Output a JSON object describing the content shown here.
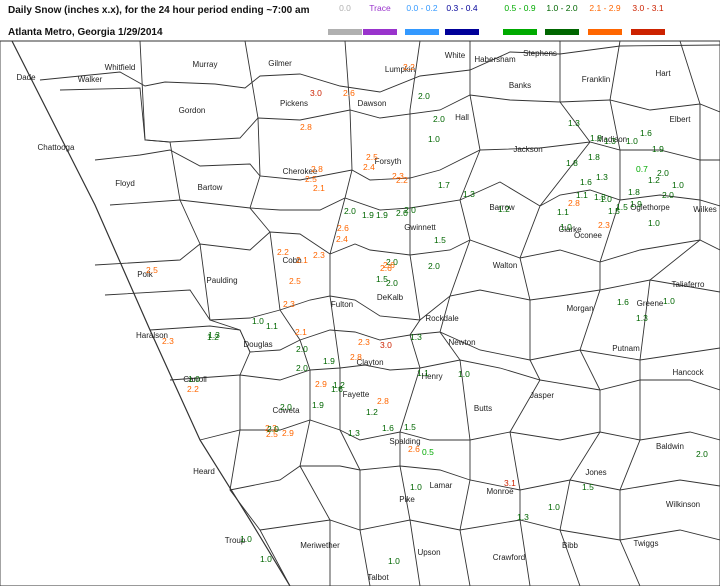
{
  "title": {
    "line1": "Daily Snow (inches x.x),  for the 24 hour period ending ~7:00 am",
    "line2": "Atlanta Metro, Georgia  1/29/2014"
  },
  "legend": [
    {
      "label": "0.0",
      "color": "#b0b0b0"
    },
    {
      "label": "Trace",
      "color": "#9933cc"
    },
    {
      "label": "0.0 - 0.2",
      "color": "#3399ff"
    },
    {
      "label": "0.3 - 0.4",
      "color": "#000099"
    },
    {
      "label": "0.5 - 0.9",
      "color": "#00aa00"
    },
    {
      "label": "1.0 - 2.0",
      "color": "#006600"
    },
    {
      "label": "2.1 - 2.9",
      "color": "#ff6600"
    },
    {
      "label": "3.0 - 3.1",
      "color": "#cc2200"
    }
  ],
  "counties": [
    "Dade",
    "Walker",
    "Whitfield",
    "Murray",
    "Gilmer",
    "Lumpkin",
    "White",
    "Habersham",
    "Stephens",
    "Franklin",
    "Hart",
    "Gordon",
    "Pickens",
    "Dawson",
    "Hall",
    "Banks",
    "Elbert",
    "Madison",
    "Chattooga",
    "Floyd",
    "Bartow",
    "Cherokee",
    "Forsyth",
    "Jackson",
    "Clarke",
    "Oglethorpe",
    "Wilkes",
    "Barrow",
    "Gwinnett",
    "Oconee",
    "Polk",
    "Paulding",
    "Cobb",
    "Walton",
    "Taliaferro",
    "Fulton",
    "DeKalb",
    "Rockdale",
    "Morgan",
    "Greene",
    "Haralson",
    "Douglas",
    "Newton",
    "Carroll",
    "Clayton",
    "Putnam",
    "Hancock",
    "Henry",
    "Jasper",
    "Fayette",
    "Coweta",
    "Butts",
    "Spalding",
    "Baldwin",
    "Heard",
    "Jones",
    "Lamar",
    "Monroe",
    "Pike",
    "Wilkinson",
    "Troup",
    "Meriwether",
    "Upson",
    "Bibb",
    "Twiggs",
    "Crawford",
    "Talbot"
  ],
  "observations": [
    "2.2",
    "3.0",
    "2.6",
    "2.0",
    "1.0",
    "2.0",
    "2.8",
    "2.5",
    "2.4",
    "2.3",
    "2.2",
    "1.3",
    "1.8",
    "1.3",
    "1.0",
    "1.7",
    "1.8",
    "1.2",
    "1.9",
    "2.8",
    "2.5",
    "2.1",
    "2.0",
    "2.0",
    "1.9",
    "2.0",
    "1.5",
    "2.6",
    "2.4",
    "2.3",
    "2.2",
    "2.1",
    "2.5",
    "2.3",
    "2.1",
    "2.0",
    "2.0",
    "1.9",
    "1.5",
    "2.0",
    "2.6",
    "2.6",
    "2.3",
    "2.0",
    "2.0",
    "1.3",
    "2.5",
    "2.3",
    "2.2",
    "1.0",
    "2.3",
    "2.0",
    "2.5",
    "2.0",
    "2.9",
    "1.9",
    "1.2",
    "1.6",
    "2.9",
    "2.8",
    "3.0",
    "1.1",
    "1.0",
    "1.3",
    "1.5",
    "2.6",
    "2.8",
    "1.6",
    "1.2",
    "1.3",
    "3.1",
    "1.0",
    "1.5",
    "1.3",
    "1.0",
    "0.5",
    "1.0",
    "1.0",
    "1.0",
    "1.2",
    "1.0",
    "1.1",
    "1.3",
    "1.6",
    "1.9",
    "2.0",
    "2.0",
    "1.0",
    "0.7",
    "1.0",
    "1.0",
    "1.9",
    "1.5",
    "1.8",
    "1.3",
    "1.0",
    "1.1",
    "1.3",
    "1.8",
    "1.6",
    "1.0",
    "1.3",
    "2.0",
    "1.2",
    "1.1",
    "1.6",
    "1.5",
    "2.8",
    "2.3",
    "2.6"
  ]
}
